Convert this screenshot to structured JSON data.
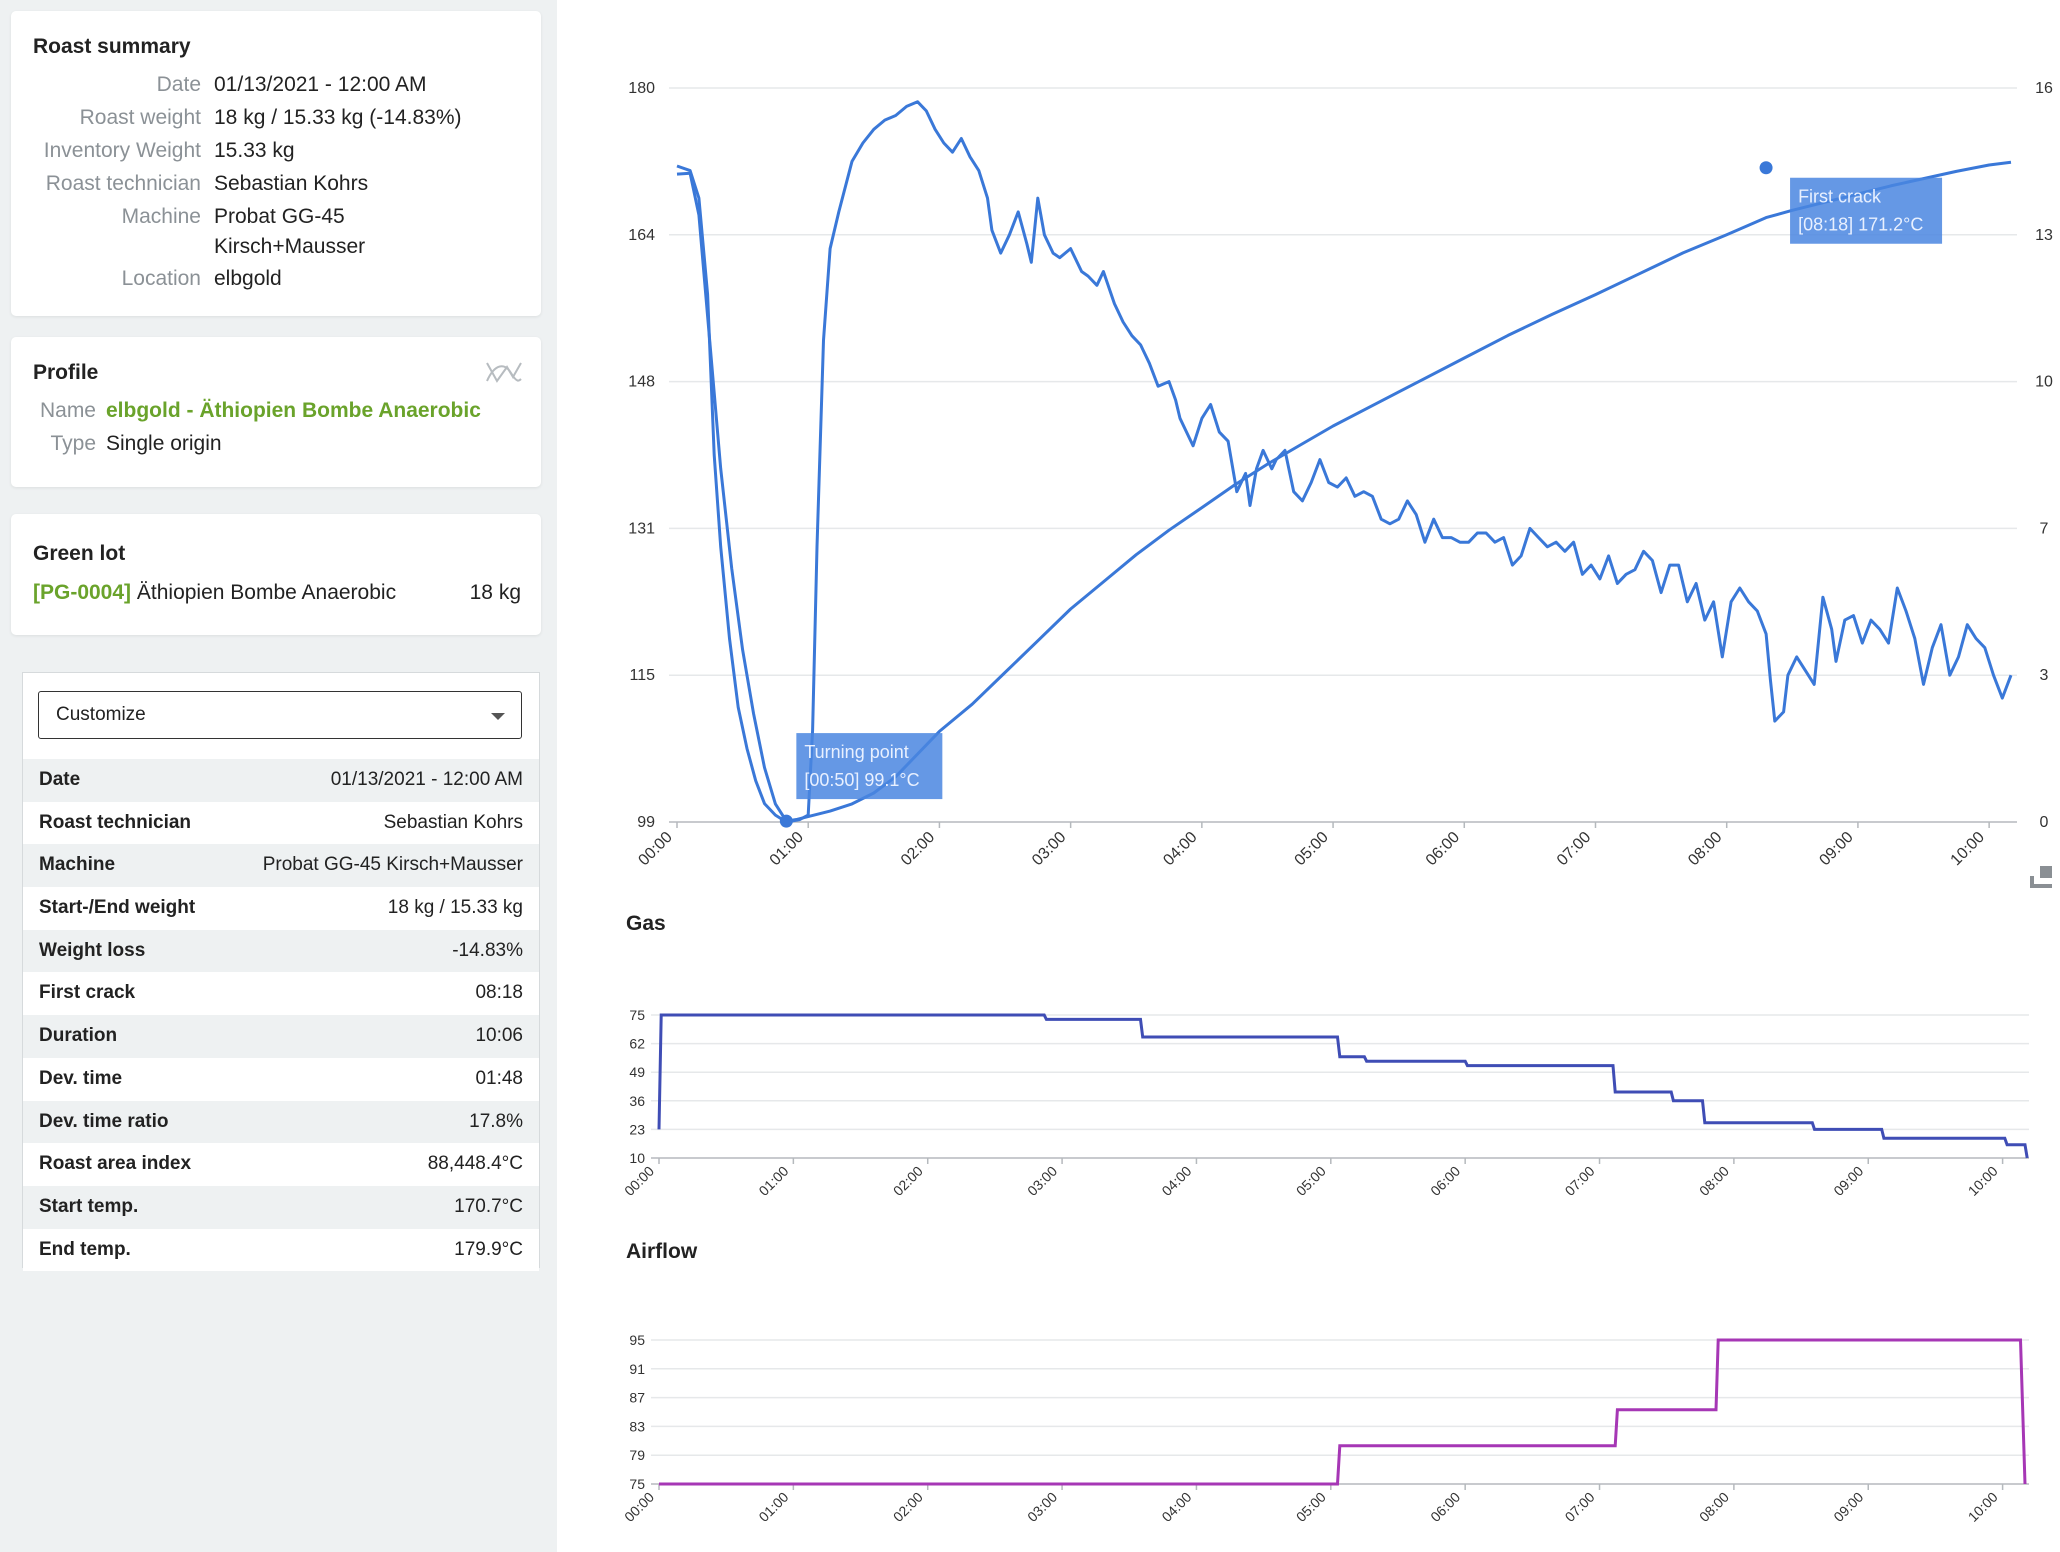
{
  "summary": {
    "title": "Roast summary",
    "rows": [
      {
        "key": "Date",
        "value": "01/13/2021 - 12:00 AM"
      },
      {
        "key": "Roast weight",
        "value": "18 kg / 15.33 kg (-14.83%)"
      },
      {
        "key": "Inventory Weight",
        "value": "15.33 kg"
      },
      {
        "key": "Roast technician",
        "value": "Sebastian Kohrs"
      },
      {
        "key": "Machine",
        "value": "Probat GG-45",
        "value2": "Kirsch+Mausser"
      },
      {
        "key": "Location",
        "value": "elbgold"
      }
    ]
  },
  "profile": {
    "title": "Profile",
    "name_key": "Name",
    "name_value": "elbgold - Äthiopien Bombe Anaerobic",
    "type_key": "Type",
    "type_value": "Single origin"
  },
  "green_lot": {
    "title": "Green lot",
    "code": "[PG-0004]",
    "name": "Äthiopien Bombe Anaerobic",
    "weight": "18 kg"
  },
  "customize": {
    "label": "Customize",
    "stats": [
      {
        "label": "Date",
        "value": "01/13/2021 - 12:00 AM"
      },
      {
        "label": "Roast technician",
        "value": "Sebastian Kohrs"
      },
      {
        "label": "Machine",
        "value": "Probat GG-45 Kirsch+Mausser"
      },
      {
        "label": "Start-/End weight",
        "value": "18 kg / 15.33 kg"
      },
      {
        "label": "Weight loss",
        "value": "-14.83%"
      },
      {
        "label": "First crack",
        "value": "08:18"
      },
      {
        "label": "Duration",
        "value": "10:06"
      },
      {
        "label": "Dev. time",
        "value": "01:48"
      },
      {
        "label": "Dev. time ratio",
        "value": "17.8%"
      },
      {
        "label": "Roast area index",
        "value": "88,448.4°C"
      },
      {
        "label": "Start temp.",
        "value": "170.7°C"
      },
      {
        "label": "End temp.",
        "value": "179.9°C"
      }
    ]
  },
  "charts": {
    "gas_title": "Gas",
    "airflow_title": "Airflow"
  },
  "chart_data": [
    {
      "type": "line",
      "name": "temperature",
      "x_ticks": [
        "00:00",
        "01:00",
        "02:00",
        "03:00",
        "04:00",
        "05:00",
        "06:00",
        "07:00",
        "08:00",
        "09:00",
        "10:00"
      ],
      "y_ticks": [
        99,
        115,
        131,
        148,
        164,
        180
      ],
      "y2_ticks": [
        0,
        3,
        7,
        10,
        13,
        16
      ],
      "ylim": [
        99,
        180
      ],
      "y2lim": [
        0,
        16
      ],
      "xlim_seconds": [
        0,
        610
      ],
      "series": [
        {
          "axis": "left",
          "points": [
            [
              0,
              170.5
            ],
            [
              6,
              170.6
            ],
            [
              10,
              166
            ],
            [
              15,
              152
            ],
            [
              20,
              138
            ],
            [
              25,
              127
            ],
            [
              30,
              118
            ],
            [
              35,
              111
            ],
            [
              40,
              105
            ],
            [
              45,
              101
            ],
            [
              50,
              99.1
            ],
            [
              55,
              99.3
            ],
            [
              60,
              99.6
            ],
            [
              70,
              100.2
            ],
            [
              80,
              101
            ],
            [
              90,
              102.2
            ],
            [
              100,
              104
            ],
            [
              110,
              106.5
            ],
            [
              120,
              109
            ],
            [
              135,
              112
            ],
            [
              150,
              115.5
            ],
            [
              165,
              119
            ],
            [
              180,
              122.5
            ],
            [
              195,
              125.5
            ],
            [
              210,
              128.5
            ],
            [
              225,
              131.2
            ],
            [
              240,
              133.7
            ],
            [
              255,
              136.2
            ],
            [
              270,
              138.5
            ],
            [
              285,
              140.6
            ],
            [
              300,
              142.7
            ],
            [
              320,
              145.2
            ],
            [
              340,
              147.7
            ],
            [
              360,
              150.2
            ],
            [
              380,
              152.7
            ],
            [
              400,
              155
            ],
            [
              420,
              157.2
            ],
            [
              440,
              159.5
            ],
            [
              460,
              161.8
            ],
            [
              480,
              163.8
            ],
            [
              498,
              165.7
            ],
            [
              510,
              166.5
            ],
            [
              525,
              167.4
            ],
            [
              540,
              168.3
            ],
            [
              555,
              169.2
            ],
            [
              570,
              170
            ],
            [
              585,
              170.8
            ],
            [
              600,
              171.5
            ],
            [
              610,
              171.8
            ]
          ]
        },
        {
          "axis": "right",
          "points": [
            [
              0,
              14.3
            ],
            [
              6,
              14.2
            ],
            [
              10,
              13.6
            ],
            [
              14,
              11.5
            ],
            [
              17,
              8
            ],
            [
              20,
              6
            ],
            [
              24,
              4
            ],
            [
              28,
              2.5
            ],
            [
              32,
              1.6
            ],
            [
              36,
              0.9
            ],
            [
              40,
              0.4
            ],
            [
              45,
              0.15
            ],
            [
              50,
              0
            ],
            [
              56,
              0.05
            ],
            [
              60,
              0.15
            ],
            [
              62,
              2
            ],
            [
              64,
              6
            ],
            [
              67,
              10.5
            ],
            [
              70,
              12.5
            ],
            [
              74,
              13.3
            ],
            [
              80,
              14.4
            ],
            [
              85,
              14.8
            ],
            [
              90,
              15.1
            ],
            [
              95,
              15.3
            ],
            [
              100,
              15.4
            ],
            [
              105,
              15.6
            ],
            [
              110,
              15.7
            ],
            [
              114,
              15.5
            ],
            [
              118,
              15.1
            ],
            [
              122,
              14.8
            ],
            [
              126,
              14.6
            ],
            [
              130,
              14.9
            ],
            [
              134,
              14.5
            ],
            [
              138,
              14.2
            ],
            [
              142,
              13.6
            ],
            [
              144,
              12.9
            ],
            [
              148,
              12.4
            ],
            [
              152,
              12.8
            ],
            [
              156,
              13.3
            ],
            [
              160,
              12.6
            ],
            [
              162,
              12.2
            ],
            [
              165,
              13.6
            ],
            [
              168,
              12.8
            ],
            [
              172,
              12.4
            ],
            [
              175,
              12.3
            ],
            [
              180,
              12.5
            ],
            [
              185,
              12
            ],
            [
              188,
              11.9
            ],
            [
              192,
              11.7
            ],
            [
              195,
              12
            ],
            [
              200,
              11.3
            ],
            [
              204,
              10.9
            ],
            [
              208,
              10.6
            ],
            [
              212,
              10.4
            ],
            [
              216,
              10
            ],
            [
              220,
              9.5
            ],
            [
              225,
              9.6
            ],
            [
              228,
              9.2
            ],
            [
              230,
              8.8
            ],
            [
              234,
              8.4
            ],
            [
              236,
              8.2
            ],
            [
              240,
              8.8
            ],
            [
              244,
              9.1
            ],
            [
              248,
              8.5
            ],
            [
              252,
              8.3
            ],
            [
              256,
              7.2
            ],
            [
              260,
              7.6
            ],
            [
              262,
              6.9
            ],
            [
              265,
              7.7
            ],
            [
              268,
              8.1
            ],
            [
              272,
              7.7
            ],
            [
              274,
              7.9
            ],
            [
              278,
              8.1
            ],
            [
              282,
              7.2
            ],
            [
              286,
              7
            ],
            [
              290,
              7.4
            ],
            [
              294,
              7.9
            ],
            [
              298,
              7.4
            ],
            [
              302,
              7.3
            ],
            [
              306,
              7.5
            ],
            [
              310,
              7.1
            ],
            [
              314,
              7.2
            ],
            [
              318,
              7.1
            ],
            [
              322,
              6.6
            ],
            [
              326,
              6.5
            ],
            [
              330,
              6.6
            ],
            [
              334,
              7
            ],
            [
              338,
              6.7
            ],
            [
              342,
              6.1
            ],
            [
              346,
              6.6
            ],
            [
              350,
              6.2
            ],
            [
              354,
              6.2
            ],
            [
              358,
              6.1
            ],
            [
              362,
              6.1
            ],
            [
              366,
              6.3
            ],
            [
              370,
              6.3
            ],
            [
              374,
              6.1
            ],
            [
              378,
              6.2
            ],
            [
              382,
              5.6
            ],
            [
              386,
              5.8
            ],
            [
              390,
              6.4
            ],
            [
              394,
              6.2
            ],
            [
              398,
              6
            ],
            [
              402,
              6.1
            ],
            [
              406,
              5.9
            ],
            [
              410,
              6.1
            ],
            [
              414,
              5.4
            ],
            [
              418,
              5.6
            ],
            [
              422,
              5.3
            ],
            [
              426,
              5.8
            ],
            [
              430,
              5.2
            ],
            [
              434,
              5.4
            ],
            [
              438,
              5.5
            ],
            [
              442,
              5.9
            ],
            [
              446,
              5.7
            ],
            [
              450,
              5
            ],
            [
              454,
              5.6
            ],
            [
              458,
              5.6
            ],
            [
              462,
              4.8
            ],
            [
              466,
              5.2
            ],
            [
              470,
              4.4
            ],
            [
              474,
              4.8
            ],
            [
              478,
              3.6
            ],
            [
              482,
              4.8
            ],
            [
              486,
              5.1
            ],
            [
              490,
              4.8
            ],
            [
              494,
              4.6
            ],
            [
              498,
              4.1
            ],
            [
              500,
              3.1
            ],
            [
              502,
              2.2
            ],
            [
              506,
              2.4
            ],
            [
              508,
              3.2
            ],
            [
              512,
              3.6
            ],
            [
              516,
              3.3
            ],
            [
              520,
              3
            ],
            [
              524,
              4.9
            ],
            [
              528,
              4.2
            ],
            [
              530,
              3.5
            ],
            [
              534,
              4.4
            ],
            [
              538,
              4.5
            ],
            [
              542,
              3.9
            ],
            [
              546,
              4.4
            ],
            [
              550,
              4.2
            ],
            [
              554,
              3.9
            ],
            [
              558,
              5.1
            ],
            [
              562,
              4.6
            ],
            [
              566,
              4
            ],
            [
              570,
              3
            ],
            [
              574,
              3.8
            ],
            [
              578,
              4.3
            ],
            [
              582,
              3.2
            ],
            [
              586,
              3.6
            ],
            [
              590,
              4.3
            ],
            [
              594,
              4
            ],
            [
              598,
              3.8
            ],
            [
              602,
              3.2
            ],
            [
              606,
              2.7
            ],
            [
              610,
              3.2
            ]
          ]
        }
      ],
      "annotations": [
        {
          "label": "Turning point",
          "text": "[00:50] 99.1°C",
          "x": 50,
          "y": 99.1
        },
        {
          "label": "First crack",
          "text": "[08:18] 171.2°C",
          "x": 498,
          "y": 171.2
        }
      ]
    },
    {
      "type": "line",
      "name": "Gas",
      "x_ticks": [
        "00:00",
        "01:00",
        "02:00",
        "03:00",
        "04:00",
        "05:00",
        "06:00",
        "07:00",
        "08:00",
        "09:00",
        "10:00"
      ],
      "y_ticks": [
        10,
        23,
        36,
        49,
        62,
        75
      ],
      "ylim": [
        10,
        75
      ],
      "xlim_seconds": [
        0,
        610
      ],
      "color": "#3f4db5",
      "points": [
        [
          0,
          23
        ],
        [
          1,
          75
        ],
        [
          2,
          75
        ],
        [
          172,
          75
        ],
        [
          173,
          73
        ],
        [
          215,
          73
        ],
        [
          216,
          65
        ],
        [
          303,
          65
        ],
        [
          304,
          56
        ],
        [
          315,
          56
        ],
        [
          316,
          54
        ],
        [
          360,
          54
        ],
        [
          361,
          52
        ],
        [
          426,
          52
        ],
        [
          427,
          40
        ],
        [
          452,
          40
        ],
        [
          453,
          36
        ],
        [
          466,
          36
        ],
        [
          467,
          26
        ],
        [
          515,
          26
        ],
        [
          516,
          23
        ],
        [
          546,
          23
        ],
        [
          547,
          19
        ],
        [
          601,
          19
        ],
        [
          602,
          16
        ],
        [
          610,
          16
        ],
        [
          611,
          10
        ]
      ]
    },
    {
      "type": "line",
      "name": "Airflow",
      "x_ticks": [
        "00:00",
        "01:00",
        "02:00",
        "03:00",
        "04:00",
        "05:00",
        "06:00",
        "07:00",
        "08:00",
        "09:00",
        "10:00"
      ],
      "y_ticks": [
        75,
        79,
        83,
        87,
        91,
        95
      ],
      "ylim": [
        75,
        95
      ],
      "xlim_seconds": [
        0,
        610
      ],
      "color": "#a637b5",
      "points": [
        [
          0,
          75
        ],
        [
          303,
          75
        ],
        [
          304,
          80.3
        ],
        [
          427,
          80.3
        ],
        [
          428,
          85.3
        ],
        [
          472,
          85.3
        ],
        [
          473,
          95
        ],
        [
          608,
          95
        ],
        [
          610,
          75
        ]
      ]
    }
  ],
  "colors": {
    "line_blue": "#3a78d8",
    "annotation_bg": "#4a86e0",
    "gas": "#3f4db5",
    "airflow": "#a637b5",
    "green": "#6aa32b"
  },
  "icons": [
    "profile-curve-icon",
    "chevron-down-icon",
    "expand-icon"
  ]
}
